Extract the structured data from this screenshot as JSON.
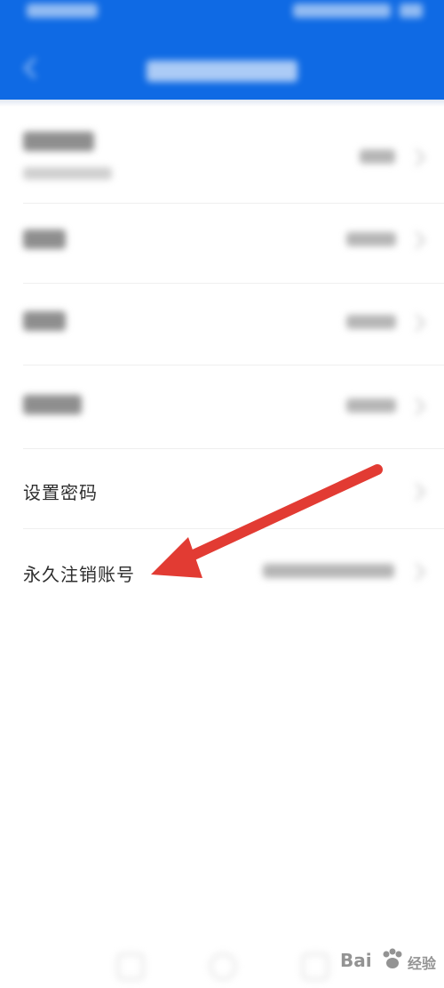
{
  "rows": {
    "set_password": {
      "label": "设置密码"
    },
    "delete_account": {
      "label": "永久注销账号"
    }
  },
  "watermark": {
    "brand": "Bai",
    "sub": "经验"
  },
  "colors": {
    "header_blue": "#0f6ae4",
    "arrow_red": "#e23b33"
  }
}
